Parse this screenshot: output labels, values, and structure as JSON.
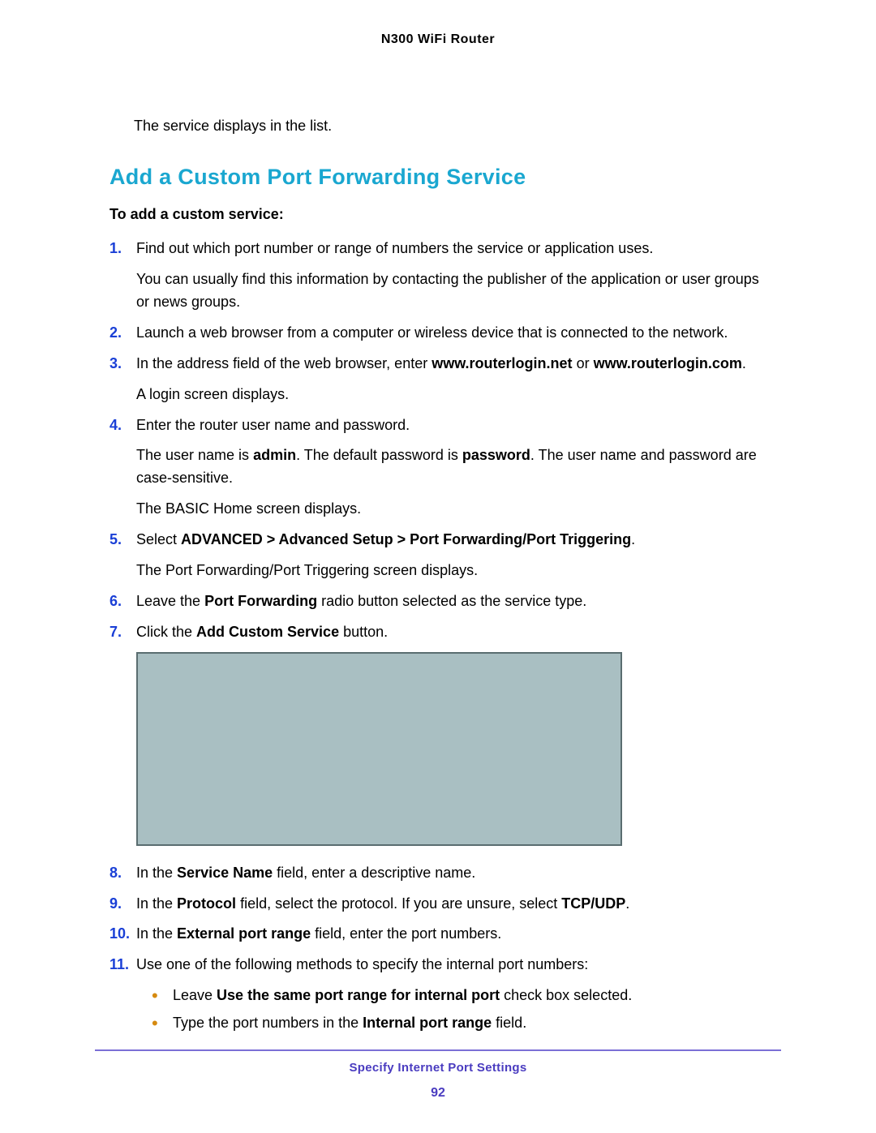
{
  "header": {
    "title": "N300 WiFi Router"
  },
  "intro": "The service displays in the list.",
  "heading": "Add a Custom Port Forwarding Service",
  "lead": "To add a custom service:",
  "steps": {
    "s1": {
      "num": "1.",
      "a": "Find out which port number or range of numbers the service or application uses.",
      "b": "You can usually find this information by contacting the publisher of the application or user groups or news groups."
    },
    "s2": {
      "num": "2.",
      "a": "Launch a web browser from a computer or wireless device that is connected to the network."
    },
    "s3": {
      "num": "3.",
      "a_pre": "In the address field of the web browser, enter ",
      "url1": "www.routerlogin.net",
      "a_mid": " or ",
      "url2": "www.routerlogin.com",
      "a_post": ".",
      "b": "A login screen displays."
    },
    "s4": {
      "num": "4.",
      "a": "Enter the router user name and password.",
      "b_pre": "The user name is ",
      "b_admin": "admin",
      "b_mid": ". The default password is ",
      "b_pw": "password",
      "b_post": ". The user name and password are case-sensitive.",
      "c": "The BASIC Home screen displays."
    },
    "s5": {
      "num": "5.",
      "a_pre": "Select ",
      "a_path": "ADVANCED > Advanced Setup > Port Forwarding/Port Triggering",
      "a_post": ".",
      "b": "The Port Forwarding/Port Triggering screen displays."
    },
    "s6": {
      "num": "6.",
      "a_pre": "Leave the ",
      "a_bold": "Port Forwarding",
      "a_post": " radio button selected as the service type."
    },
    "s7": {
      "num": "7.",
      "a_pre": "Click the ",
      "a_bold": "Add Custom Service",
      "a_post": " button."
    },
    "s8": {
      "num": "8.",
      "a_pre": "In the ",
      "a_bold": "Service Name",
      "a_post": " field, enter a descriptive name."
    },
    "s9": {
      "num": "9.",
      "a_pre": "In the ",
      "a_bold": "Protocol",
      "a_mid": " field, select the protocol. If you are unsure, select ",
      "a_bold2": "TCP/UDP",
      "a_post": "."
    },
    "s10": {
      "num": "10.",
      "a_pre": "In the ",
      "a_bold": "External port range",
      "a_post": " field, enter the port numbers."
    },
    "s11": {
      "num": "11.",
      "a": "Use one of the following methods to specify the internal port numbers:",
      "b1_pre": "Leave ",
      "b1_bold": "Use the same port range for internal port",
      "b1_post": " check box selected.",
      "b2_pre": "Type the port numbers in the ",
      "b2_bold": "Internal port range",
      "b2_post": " field."
    }
  },
  "footer": {
    "section": "Specify Internet Port Settings",
    "page": "92"
  }
}
